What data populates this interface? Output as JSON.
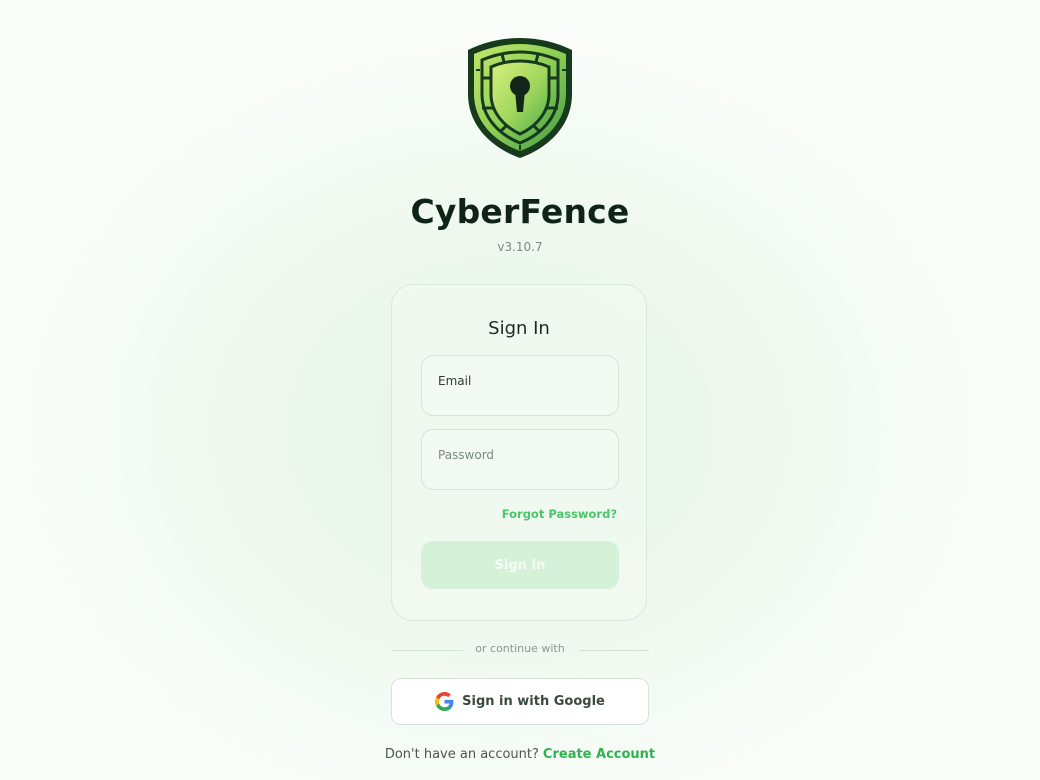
{
  "app": {
    "name": "CyberFence",
    "version": "v3.10.7",
    "logo_icon": "shield-keyhole-icon"
  },
  "colors": {
    "accent": "#4cc46a",
    "accent_dark": "#2fb24f",
    "button_disabled_bg": "#d5f1d8",
    "shield_green_light": "#b8e06a",
    "shield_green_dark": "#3f9a44"
  },
  "login_form": {
    "title": "Sign In",
    "email_placeholder": "Email",
    "email_value": "",
    "password_placeholder": "Password",
    "password_value": "",
    "forgot_password_label": "Forgot Password?",
    "submit_label": "Sign In"
  },
  "divider_text": "or continue with",
  "google": {
    "label": "Sign in with Google",
    "icon": "google-g-icon"
  },
  "signup": {
    "prompt": "Don't have an account?",
    "link_label": "Create Account"
  }
}
